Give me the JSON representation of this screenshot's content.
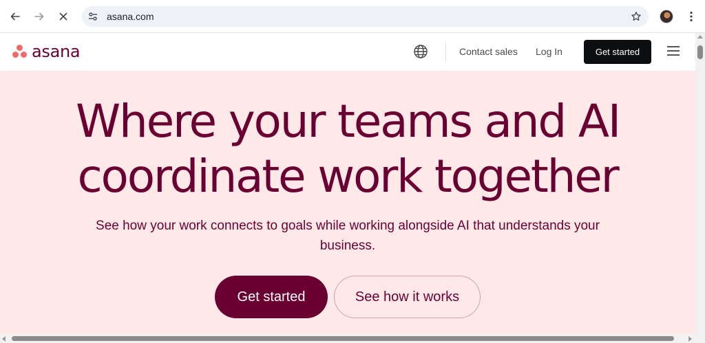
{
  "browser": {
    "url": "asana.com",
    "icons": {
      "back": "arrow-left-icon",
      "forward": "arrow-right-icon",
      "stop": "close-icon",
      "site_info": "tune-icon",
      "bookmark": "star-icon",
      "menu": "more-vertical-icon"
    }
  },
  "header": {
    "logo_text": "asana",
    "contact_sales": "Contact sales",
    "log_in": "Log In",
    "get_started": "Get started",
    "icons": {
      "language": "globe-icon",
      "menu": "hamburger-icon"
    }
  },
  "hero": {
    "title_line1": "Where your teams and AI",
    "title_line2": "coordinate work together",
    "subtitle": "See how your work connects to goals while working alongside AI that understands your business.",
    "cta_primary": "Get started",
    "cta_secondary": "See how it works"
  },
  "colors": {
    "brand": "#690031",
    "hero_background": "#ffe8e8",
    "logo_accent": "#f06a6a",
    "header_button": "#0d0e10"
  }
}
